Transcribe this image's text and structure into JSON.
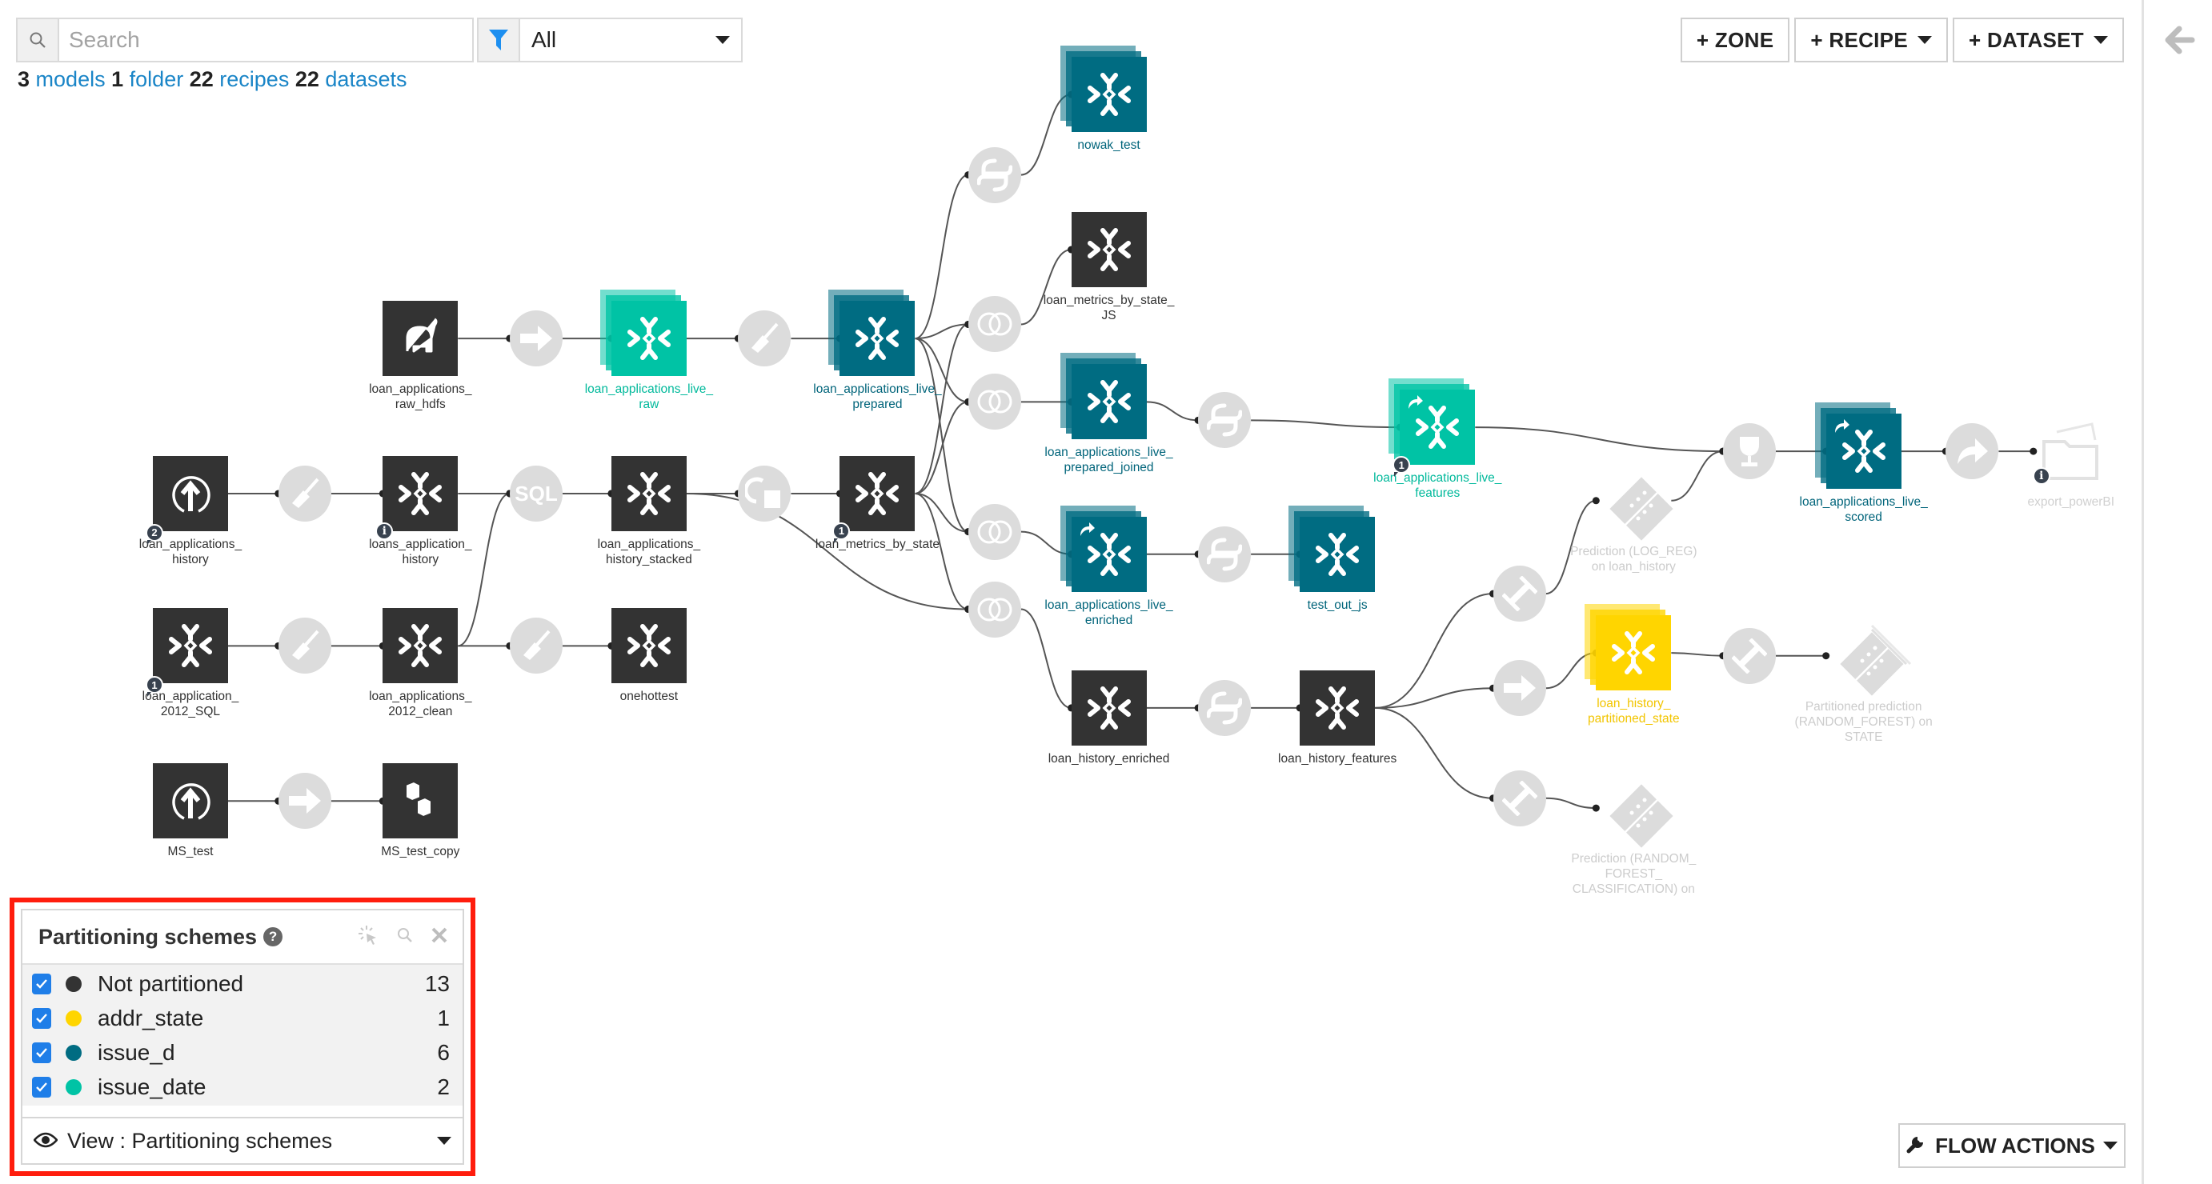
{
  "toolbar": {
    "search_placeholder": "Search",
    "search_value": "",
    "filter_value": "All",
    "buttons": {
      "zone": "+ ZONE",
      "recipe": "+ RECIPE",
      "dataset": "+ DATASET"
    }
  },
  "counts": {
    "models_n": "3",
    "models_label": "models",
    "folder_n": "1",
    "folder_label": "folder",
    "recipes_n": "22",
    "recipes_label": "recipes",
    "datasets_n": "22",
    "datasets_label": "datasets"
  },
  "colors": {
    "not_partitioned": "#333333",
    "addr_state": "#ffd500",
    "issue_d": "#006c82",
    "issue_date": "#00c3a5",
    "recipe": "#dcdcdc",
    "highlight_frame": "#ff1d0d",
    "link": "#1a85c7"
  },
  "datasets": [
    {
      "id": "hdfs",
      "label": "loan_applications_raw_hdfs",
      "lines": [
        "loan_applications_",
        "raw_hdfs"
      ],
      "scheme": "not_partitioned",
      "icon": "hadoop-elephant",
      "stacked": false
    },
    {
      "id": "live_raw",
      "label": "loan_applications_live_raw",
      "lines": [
        "loan_applications_live_",
        "raw"
      ],
      "scheme": "issue_date",
      "icon": "snowflake",
      "stacked": true
    },
    {
      "id": "live_prepared",
      "label": "loan_applications_live_prepared",
      "lines": [
        "loan_applications_live_",
        "prepared"
      ],
      "scheme": "issue_d",
      "icon": "snowflake",
      "stacked": true
    },
    {
      "id": "app_history",
      "label": "loan_applications_history",
      "lines": [
        "loan_applications_",
        "history"
      ],
      "scheme": "not_partitioned",
      "icon": "upload",
      "stacked": false
    },
    {
      "id": "loans_app_history",
      "label": "loans_application_history",
      "lines": [
        "loans_application_",
        "history"
      ],
      "scheme": "not_partitioned",
      "icon": "snowflake",
      "stacked": false
    },
    {
      "id": "history_stacked",
      "label": "loan_applications_history_stacked",
      "lines": [
        "loan_applications_",
        "history_stacked"
      ],
      "scheme": "not_partitioned",
      "icon": "snowflake",
      "stacked": false
    },
    {
      "id": "metrics_by_state",
      "label": "loan_metrics_by_state",
      "lines": [
        "loan_metrics_by_state"
      ],
      "scheme": "not_partitioned",
      "icon": "snowflake",
      "stacked": false
    },
    {
      "id": "sql2012",
      "label": "loan_application_2012_SQL",
      "lines": [
        "loan_application_",
        "2012_SQL"
      ],
      "scheme": "not_partitioned",
      "icon": "snowflake",
      "stacked": false
    },
    {
      "id": "clean2012",
      "label": "loan_applications_2012_clean",
      "lines": [
        "loan_applications_",
        "2012_clean"
      ],
      "scheme": "not_partitioned",
      "icon": "snowflake",
      "stacked": false
    },
    {
      "id": "onehottest",
      "label": "onehottest",
      "lines": [
        "onehottest"
      ],
      "scheme": "not_partitioned",
      "icon": "snowflake",
      "stacked": false
    },
    {
      "id": "ms_test",
      "label": "MS_test",
      "lines": [
        "MS_test"
      ],
      "scheme": "not_partitioned",
      "icon": "upload",
      "stacked": false
    },
    {
      "id": "ms_test_copy",
      "label": "MS_test_copy",
      "lines": [
        "MS_test_copy"
      ],
      "scheme": "not_partitioned",
      "icon": "cubes",
      "stacked": false
    },
    {
      "id": "nowak_test",
      "label": "nowak_test",
      "lines": [
        "nowak_test"
      ],
      "scheme": "issue_d",
      "icon": "snowflake",
      "stacked": true
    },
    {
      "id": "metrics_js",
      "label": "loan_metrics_by_state_JS",
      "lines": [
        "loan_metrics_by_state_",
        "JS"
      ],
      "scheme": "not_partitioned",
      "icon": "snowflake",
      "stacked": false
    },
    {
      "id": "prepared_joined",
      "label": "loan_applications_live_prepared_joined",
      "lines": [
        "loan_applications_live_",
        "prepared_joined"
      ],
      "scheme": "issue_d",
      "icon": "snowflake",
      "stacked": true
    },
    {
      "id": "live_enriched",
      "label": "loan_applications_live_enriched",
      "lines": [
        "loan_applications_live_",
        "enriched"
      ],
      "scheme": "issue_d",
      "icon": "snowflake",
      "stacked": true,
      "shared": true
    },
    {
      "id": "history_enriched",
      "label": "loan_history_enriched",
      "lines": [
        "loan_history_enriched"
      ],
      "scheme": "not_partitioned",
      "icon": "snowflake",
      "stacked": false
    },
    {
      "id": "test_out_js",
      "label": "test_out_js",
      "lines": [
        "test_out_js"
      ],
      "scheme": "issue_d",
      "icon": "snowflake",
      "stacked": true
    },
    {
      "id": "history_features",
      "label": "loan_history_features",
      "lines": [
        "loan_history_features"
      ],
      "scheme": "not_partitioned",
      "icon": "snowflake",
      "stacked": false
    },
    {
      "id": "live_features",
      "label": "loan_applications_live_features",
      "lines": [
        "loan_applications_live_",
        "features"
      ],
      "scheme": "issue_date",
      "icon": "snowflake",
      "stacked": true,
      "shared": true
    },
    {
      "id": "partitioned_state",
      "label": "loan_history_partitioned_state",
      "lines": [
        "loan_history_",
        "partitioned_state"
      ],
      "scheme": "addr_state",
      "icon": "snowflake",
      "stacked": true
    },
    {
      "id": "live_scored",
      "label": "loan_applications_live_scored",
      "lines": [
        "loan_applications_live_",
        "scored"
      ],
      "scheme": "issue_d",
      "icon": "snowflake",
      "stacked": true,
      "shared": true
    }
  ],
  "folder": {
    "id": "export_powerbi",
    "label": "export_powerBI",
    "lines": [
      "export_powerBI"
    ]
  },
  "models": [
    {
      "id": "model_logreg",
      "lines": [
        "Prediction (LOG_REG)",
        "on loan_history"
      ]
    },
    {
      "id": "model_rf_part",
      "lines": [
        "Partitioned prediction",
        "(RANDOM_FOREST) on",
        "STATE"
      ],
      "stacked": true
    },
    {
      "id": "model_rf_cls",
      "lines": [
        "Prediction (RANDOM_",
        "FOREST_",
        "CLASSIFICATION) on"
      ]
    }
  ],
  "recipes": [
    {
      "id": "r_sync1",
      "type": "sync"
    },
    {
      "id": "r_prep_live",
      "type": "prepare"
    },
    {
      "id": "r_prep_hist",
      "type": "prepare"
    },
    {
      "id": "r_sql",
      "type": "sql"
    },
    {
      "id": "r_split",
      "type": "split"
    },
    {
      "id": "r_prep_2012",
      "type": "prepare"
    },
    {
      "id": "r_prep_onehot",
      "type": "prepare"
    },
    {
      "id": "r_sync_ms",
      "type": "sync"
    },
    {
      "id": "r_py_nowak",
      "type": "python"
    },
    {
      "id": "r_join_js",
      "type": "join"
    },
    {
      "id": "r_join_prep",
      "type": "join"
    },
    {
      "id": "r_join_enr",
      "type": "join"
    },
    {
      "id": "r_join_hist",
      "type": "join"
    },
    {
      "id": "r_py_feat",
      "type": "python"
    },
    {
      "id": "r_py_testout",
      "type": "python"
    },
    {
      "id": "r_py_histfeat",
      "type": "python"
    },
    {
      "id": "r_train_logreg",
      "type": "train"
    },
    {
      "id": "r_sync_part",
      "type": "sync"
    },
    {
      "id": "r_train_rf",
      "type": "train"
    },
    {
      "id": "r_score",
      "type": "score"
    },
    {
      "id": "r_train_part",
      "type": "train"
    },
    {
      "id": "r_export",
      "type": "export"
    }
  ],
  "partition_panel": {
    "title": "Partitioning schemes",
    "rows": [
      {
        "label": "Not partitioned",
        "count": "13",
        "color": "#333333",
        "checked": true
      },
      {
        "label": "addr_state",
        "count": "1",
        "color": "#ffd500",
        "checked": true
      },
      {
        "label": "issue_d",
        "count": "6",
        "color": "#006c82",
        "checked": true
      },
      {
        "label": "issue_date",
        "count": "2",
        "color": "#00c3a5",
        "checked": true
      }
    ],
    "view_label": "View : Partitioning schemes"
  },
  "flow_actions": {
    "label": "FLOW ACTIONS"
  }
}
